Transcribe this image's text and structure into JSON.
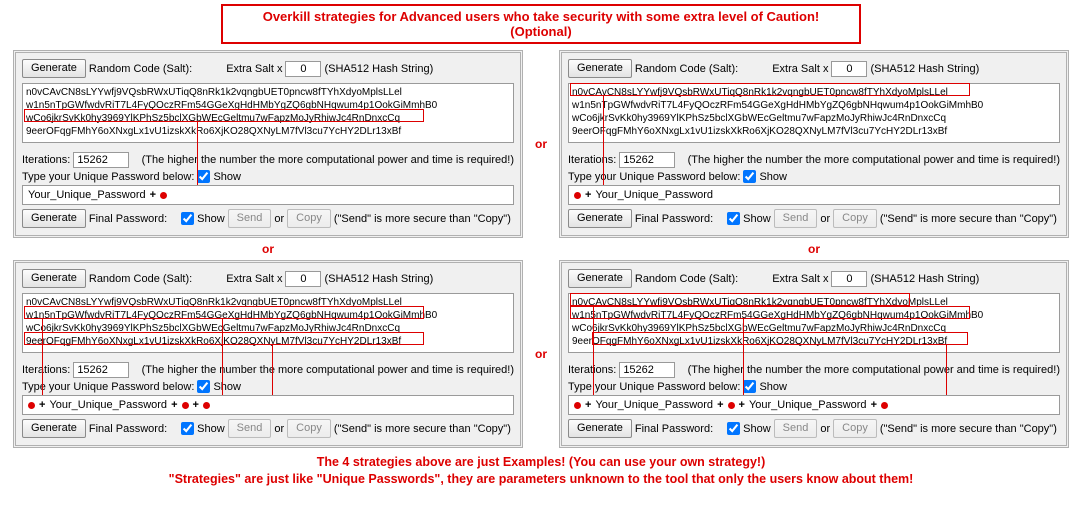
{
  "header": "Overkill strategies for Advanced users who take security with some extra level of Caution! (Optional)",
  "or": "or",
  "footer": {
    "line1": "The 4 strategies above are just Examples! (You can use your own strategy!)",
    "line2": "\"Strategies\" are just like \"Unique Passwords\", they are parameters unknown to the tool that only the users know about them!"
  },
  "labels": {
    "generate": "Generate",
    "random_code": "Random Code (Salt):",
    "extra_salt": "Extra Salt   x",
    "hash_str": "(SHA512 Hash String)",
    "iterations": "Iterations:",
    "iter_note": "(The higher the number the more computational power and time is required!)",
    "type_pwd": "Type your Unique Password below:",
    "show": "Show",
    "final_pwd": "Final Password:",
    "send": "Send",
    "or_small": "or",
    "copy": "Copy",
    "secure_note": "(\"Send\" is more secure than \"Copy\")",
    "plus": "+"
  },
  "values": {
    "extra_salt_x": "0",
    "iterations": "15262",
    "salt_text": "n0vCAvCN8sLYYwfj9VQsbRWxUTiqQ8nRk1k2vqngbUET0pncw8fTYhXdyoMplsLLel\nw1n5nTpGWfwdvRiT7L4FyQOczRFm54GGeXgHdHMbYgZQ6gbNHqwum4p1OokGiMmhB0\nwCo6jkrSvKk0hy3969YlKPhSz5bclXGbWEcGeltmu7wFapzMoJyRhiwJc4RnDnxcCq\n9eerOFqgFMhY6oXNxgLx1vU1izskXkRo6XjKO28QXNyLM7fVl3cu7YcHY2DLr13xBf",
    "pwd": "Your_Unique_Password"
  }
}
